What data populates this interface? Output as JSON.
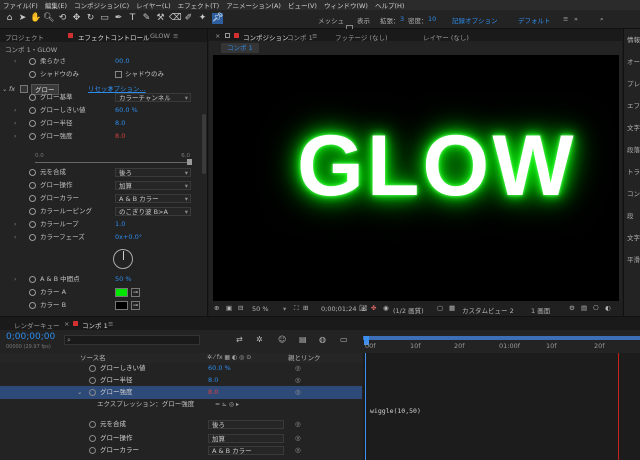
{
  "menu": [
    "ファイル(F)",
    "編集(E)",
    "コンポジション(C)",
    "レイヤー(L)",
    "エフェクト(T)",
    "アニメーション(A)",
    "ビュー(V)",
    "ウィンドウ(W)",
    "ヘルプ(H)"
  ],
  "toolbar": {
    "mesh_label": "メッシュ",
    "show_label": "表示",
    "expand_label": "拡張：",
    "expand_value": "3",
    "density_label": "密度：",
    "density_value": "10",
    "options_label": "記録オプション",
    "workspace": "デフォルト"
  },
  "left_panel": {
    "tab_project": "プロジェクト",
    "tab_effects": "エフェクトコントロール",
    "tab_effects_target": "GLOW",
    "breadcrumb": "コンポ 1・GLOW",
    "top_rows": [
      {
        "label": "柔らかさ",
        "value": "00.0"
      },
      {
        "label": "シャドウのみ",
        "value": "シャドウのみ"
      }
    ],
    "fx_label": "fx",
    "effect_name": "グロー",
    "reset_label": "リセット",
    "options_label": "オプション...",
    "rows": [
      {
        "label": "グロー基準",
        "value": "カラーチャンネル",
        "kind": "dropdown"
      },
      {
        "label": "グローしきい値",
        "value": "60.0 %",
        "kind": "value"
      },
      {
        "label": "グロー半径",
        "value": "8.0",
        "kind": "value"
      },
      {
        "label": "グロー強度",
        "value": "8.0",
        "kind": "red"
      },
      {
        "label": "元を合成",
        "value": "後ろ",
        "kind": "dropdown"
      },
      {
        "label": "グロー操作",
        "value": "加算",
        "kind": "dropdown"
      },
      {
        "label": "グローカラー",
        "value": "A & B カラー",
        "kind": "dropdown"
      },
      {
        "label": "カラールーピング",
        "value": "のこぎり波 B>A",
        "kind": "dropdown"
      },
      {
        "label": "カラーループ",
        "value": "1.0",
        "kind": "value"
      },
      {
        "label": "カラーフェーズ",
        "value": "0x+0.0°",
        "kind": "value"
      },
      {
        "label": "A & B 中間点",
        "value": "50 %",
        "kind": "value"
      },
      {
        "label": "カラー A",
        "value": "",
        "kind": "color-green"
      },
      {
        "label": "カラー B",
        "value": "",
        "kind": "color-black"
      }
    ],
    "slider_min": "0.0",
    "slider_max": "6.0"
  },
  "comp_panel": {
    "tab_label": "コンポジション",
    "tab_name": "コンポ 1",
    "footage_label": "フッテージ (なし)",
    "layer_label": "レイヤー (なし)",
    "sub_tab": "コンポ 1",
    "viewer_text": "GLOW",
    "zoom": "50 %",
    "timecode": "0;00;01;24",
    "resolution": "(1/2 画質)",
    "camera": "カスタムビュー 2",
    "view_count": "1 画面"
  },
  "right_panel": [
    "情報",
    "オー",
    "プレ",
    "エフ",
    "文字",
    "段落",
    "トラ",
    "コン",
    "段",
    "文字",
    "平滑"
  ],
  "timeline": {
    "render_queue": "レンダーキュー",
    "comp_tab": "コンポ 1",
    "timecode": "0;00;00;00",
    "fps": "00000 (29.97 fps)",
    "col_source": "ソース名",
    "col_parent": "親とリンク",
    "ruler": [
      "00f",
      "10f",
      "20f",
      "01:00f",
      "10f",
      "20f"
    ],
    "rows": [
      {
        "label": "グローしきい値",
        "value": "60.0 %"
      },
      {
        "label": "グロー半径",
        "value": "8.0"
      },
      {
        "label": "グロー強度",
        "value": "8.0"
      },
      {
        "label": "エクスプレッション：グロー強度",
        "value": ""
      },
      {
        "label": "元を合成",
        "value": "後ろ"
      },
      {
        "label": "グロー操作",
        "value": "加算"
      },
      {
        "label": "グローカラー",
        "value": "A & B カラー"
      }
    ],
    "expression": "wiggle(10,50)"
  },
  "colors": {
    "accent": "#2d8ceb",
    "glow": "#00e600",
    "timeline_red": "#c8201a"
  }
}
